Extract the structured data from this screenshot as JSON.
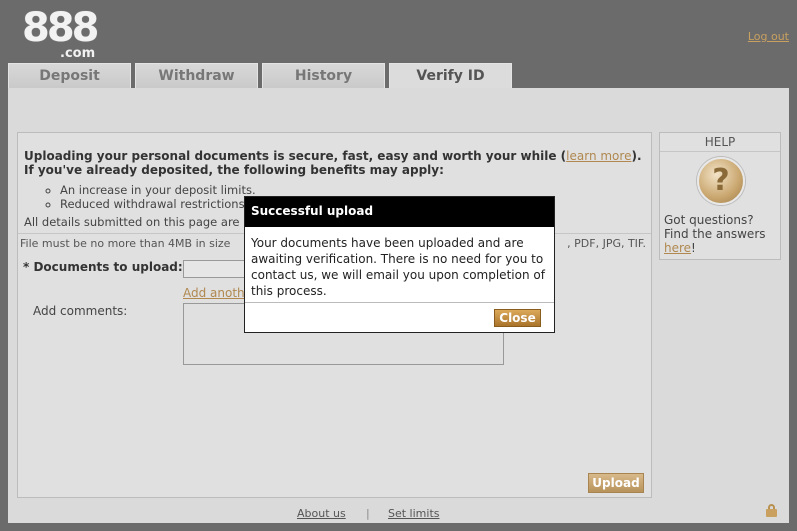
{
  "brand": {
    "digits": "888",
    "suffix": ".com"
  },
  "header": {
    "logout": "Log out"
  },
  "tabs": [
    {
      "label": "Deposit",
      "active": false
    },
    {
      "label": "Withdraw",
      "active": false
    },
    {
      "label": "History",
      "active": false
    },
    {
      "label": "Verify ID",
      "active": true
    }
  ],
  "main": {
    "intro_line1": "Uploading your personal documents is secure, fast, easy and worth your while (",
    "learn_more": "learn more",
    "intro_line1_end": ").",
    "intro_line2": "If you've already deposited, the following benefits may apply:",
    "benefits": [
      "An increase in your deposit limits.",
      "Reduced withdrawal restrictions"
    ],
    "details": "All details submitted on this page are",
    "file_note_left": "File must be no more than 4MB in size",
    "file_note_right": ", PDF, JPG, TIF.",
    "documents_label": "* Documents to upload:",
    "add_another": "Add another",
    "comments_label": "Add comments:",
    "upload_button": "Upload"
  },
  "help": {
    "title": "HELP",
    "icon": "question-icon",
    "question": "Got questions?",
    "answers_prefix": "Find the answers",
    "answers_link": "here",
    "answers_suffix": "!"
  },
  "modal": {
    "title": "Successful upload",
    "message": "Your documents have been uploaded and are awaiting verification. There is no need for you to contact us, we will email you upon completion of this process.",
    "close_button": "Close"
  },
  "footer": {
    "about": "About us",
    "divider": "|",
    "limits": "Set limits",
    "lock_icon": "lock-icon"
  },
  "colors": {
    "background": "#6b6b6b",
    "panel": "#dadada",
    "accent": "#b08850",
    "modal_header": "#000000"
  }
}
